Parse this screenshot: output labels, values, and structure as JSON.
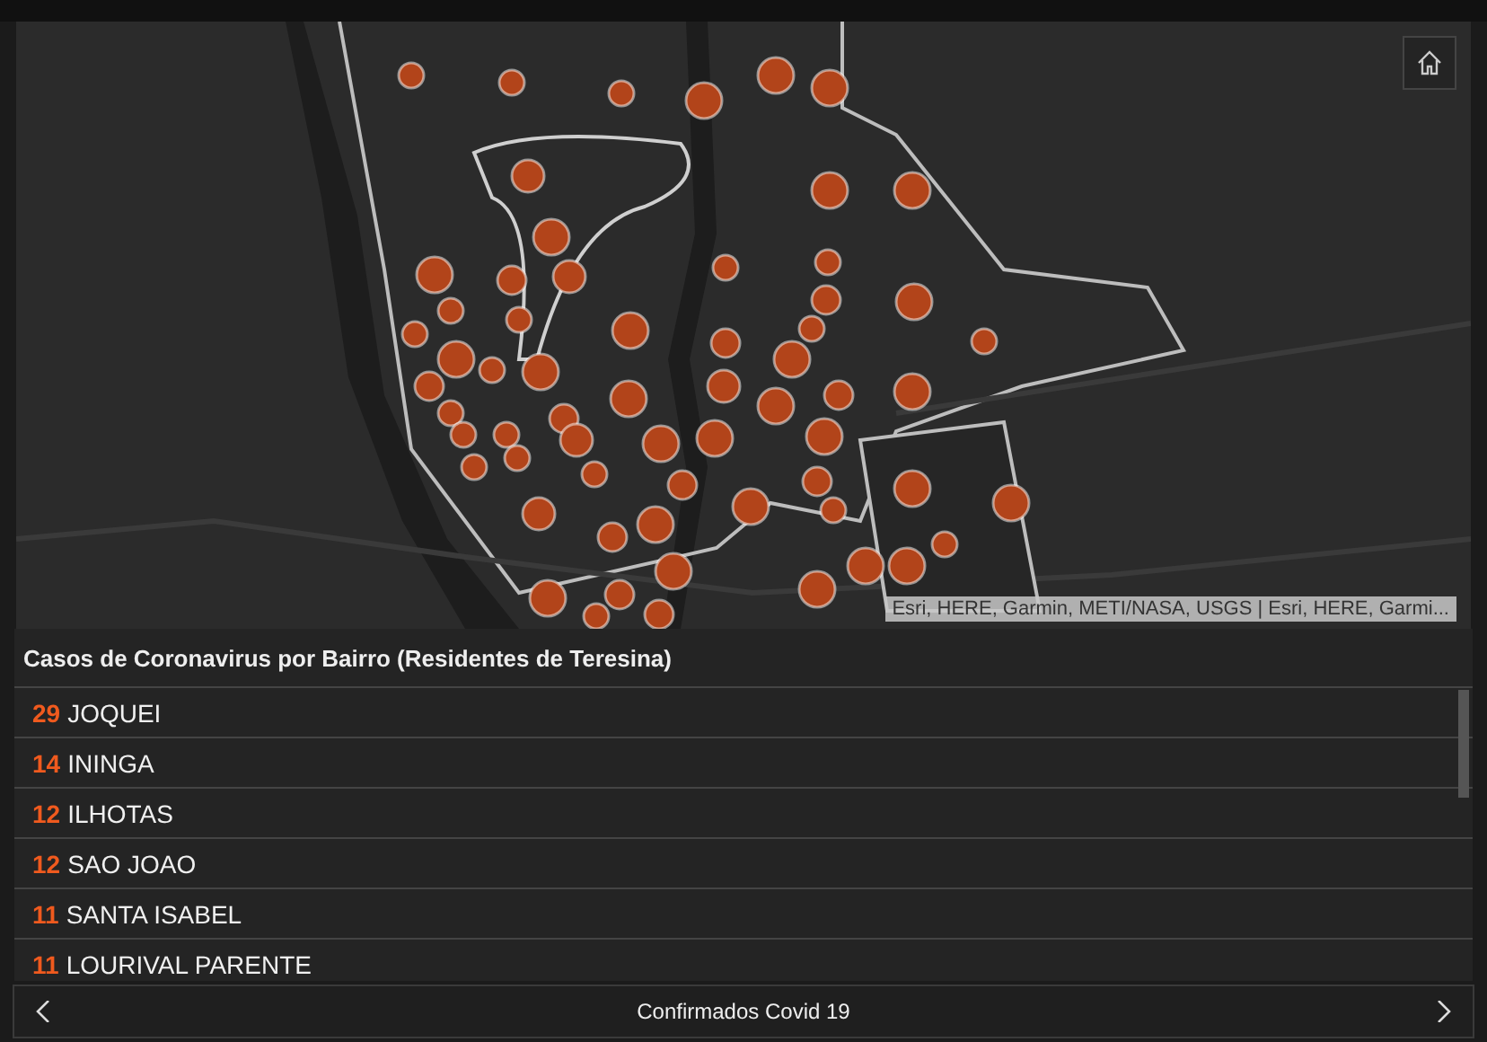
{
  "map": {
    "kind": "picture",
    "attribution": "Esri, HERE, Garmin, METI/NASA, USGS | Esri, HERE, Garmi..."
  },
  "list": {
    "title": "Casos de Coronavirus por Bairro (Residentes de Teresina)",
    "rows": [
      {
        "count": "29",
        "name": "JOQUEI"
      },
      {
        "count": "14",
        "name": "ININGA"
      },
      {
        "count": "12",
        "name": "ILHOTAS"
      },
      {
        "count": "12",
        "name": "SAO JOAO"
      },
      {
        "count": "11",
        "name": "SANTA ISABEL"
      },
      {
        "count": "11",
        "name": "LOURIVAL PARENTE"
      }
    ]
  },
  "footer": {
    "title": "Confirmados Covid 19"
  }
}
